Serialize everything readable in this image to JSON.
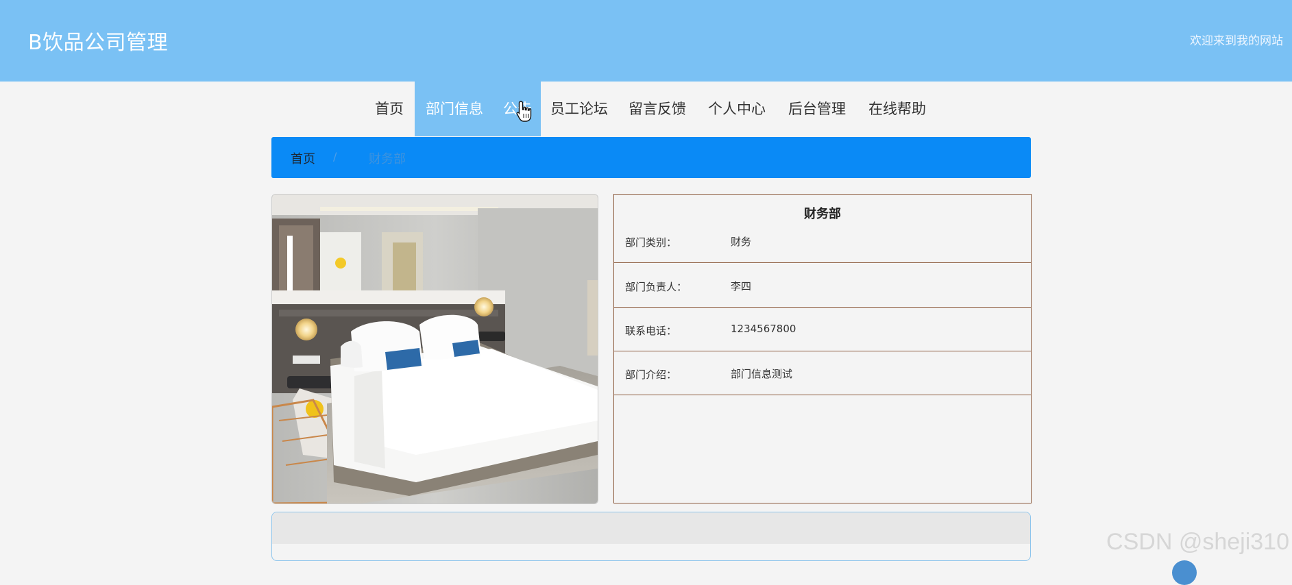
{
  "header": {
    "title": "B饮品公司管理",
    "welcome": "欢迎来到我的网站"
  },
  "nav": {
    "items": [
      {
        "label": "首页"
      },
      {
        "label": "部门信息"
      },
      {
        "label": "公告"
      },
      {
        "label": "员工论坛"
      },
      {
        "label": "留言反馈"
      },
      {
        "label": "个人中心"
      },
      {
        "label": "后台管理"
      },
      {
        "label": "在线帮助"
      }
    ]
  },
  "breadcrumb": {
    "home": "首页",
    "separator": "/",
    "current": "财务部"
  },
  "detail": {
    "title": "财务部",
    "rows": [
      {
        "label": "部门类别：",
        "value": "财务"
      },
      {
        "label": "部门负责人：",
        "value": "李四"
      },
      {
        "label": "联系电话：",
        "value": "1234567800"
      },
      {
        "label": "部门介绍：",
        "value": "部门信息测试"
      }
    ]
  },
  "watermark": "CSDN @sheji310",
  "colors": {
    "header": "#7ac1f4",
    "breadcrumb": "#0a8af6",
    "table_border": "#8b5a3c"
  },
  "icons": {
    "cursor": "hand-pointer-icon"
  }
}
